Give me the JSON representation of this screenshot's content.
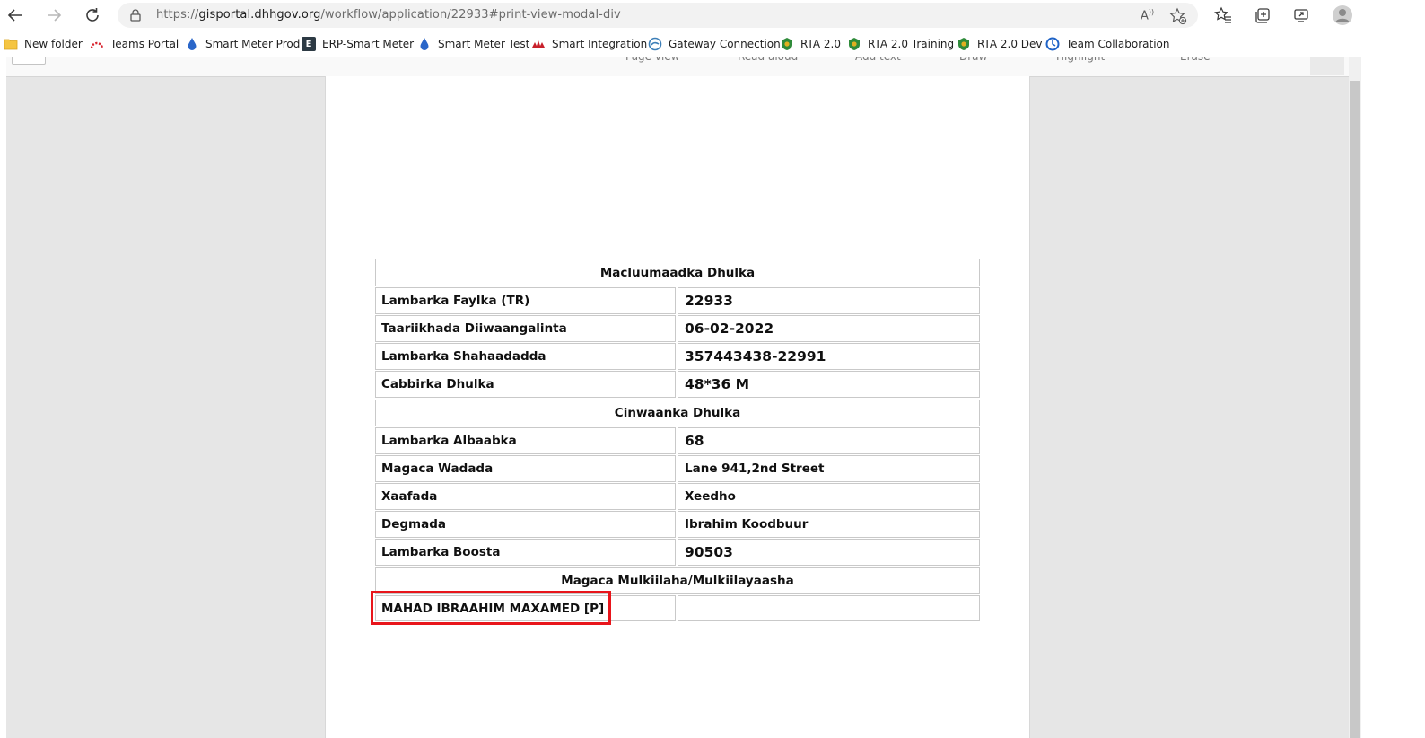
{
  "browser": {
    "url_prefix": "https://",
    "url_host": "gisportal.dhhgov.org",
    "url_path": "/workflow/application/22933#print-view-modal-div",
    "read_aloud_label": "A⁴⁾",
    "read_aloud_icon": "read-aloud-icon"
  },
  "bookmarks": [
    {
      "label": "New folder",
      "icon": "folder-icon"
    },
    {
      "label": "Teams Portal",
      "icon": "teams-portal-icon"
    },
    {
      "label": "Smart Meter Prod",
      "icon": "water-drop-icon"
    },
    {
      "label": "ERP-Smart Meter",
      "icon": "erp-icon"
    },
    {
      "label": "Smart Meter Test",
      "icon": "water-drop-icon"
    },
    {
      "label": "Smart Integration",
      "icon": "integration-icon"
    },
    {
      "label": "Gateway Connection",
      "icon": "gateway-icon"
    },
    {
      "label": "RTA 2.0",
      "icon": "rta-icon"
    },
    {
      "label": "RTA 2.0 Training",
      "icon": "rta-icon"
    },
    {
      "label": "RTA 2.0 Dev",
      "icon": "rta-icon"
    },
    {
      "label": "Team Collaboration",
      "icon": "team-collab-icon"
    }
  ],
  "pdf_toolbar": {
    "page_view": "Page view",
    "read_aloud": "Read aloud",
    "add_text": "Add text",
    "draw": "Draw",
    "highlight": "Highlight",
    "erase": "Erase"
  },
  "doc": {
    "section1_title": "Macluumaadka Dhulka",
    "section1_rows": [
      {
        "label": "Lambarka Faylka (TR)",
        "value": "22933"
      },
      {
        "label": "Taariikhada Diiwaangalinta",
        "value": "06-02-2022"
      },
      {
        "label": "Lambarka Shahaadadda",
        "value": "357443438-22991"
      },
      {
        "label": "Cabbirka Dhulka",
        "value": "48*36 M"
      }
    ],
    "section2_title": "Cinwaanka Dhulka",
    "section2_rows": [
      {
        "label": "Lambarka Albaabka",
        "value": "68"
      },
      {
        "label": "Magaca Wadada",
        "value": "Lane 941,2nd Street"
      },
      {
        "label": "Xaafada",
        "value": "Xeedho"
      },
      {
        "label": "Degmada",
        "value": "Ibrahim Koodbuur"
      },
      {
        "label": "Lambarka Boosta",
        "value": "90503"
      }
    ],
    "section3_title": "Magaca Mulkiilaha/Mulkiilayaasha",
    "owner_row": {
      "label": "MAHAD IBRAAHIM MAXAMED [P]",
      "value": ""
    }
  },
  "colors": {
    "highlight_border": "#e8151b",
    "viewer_background": "#e6e6e6",
    "table_border": "#c9c9c9"
  }
}
